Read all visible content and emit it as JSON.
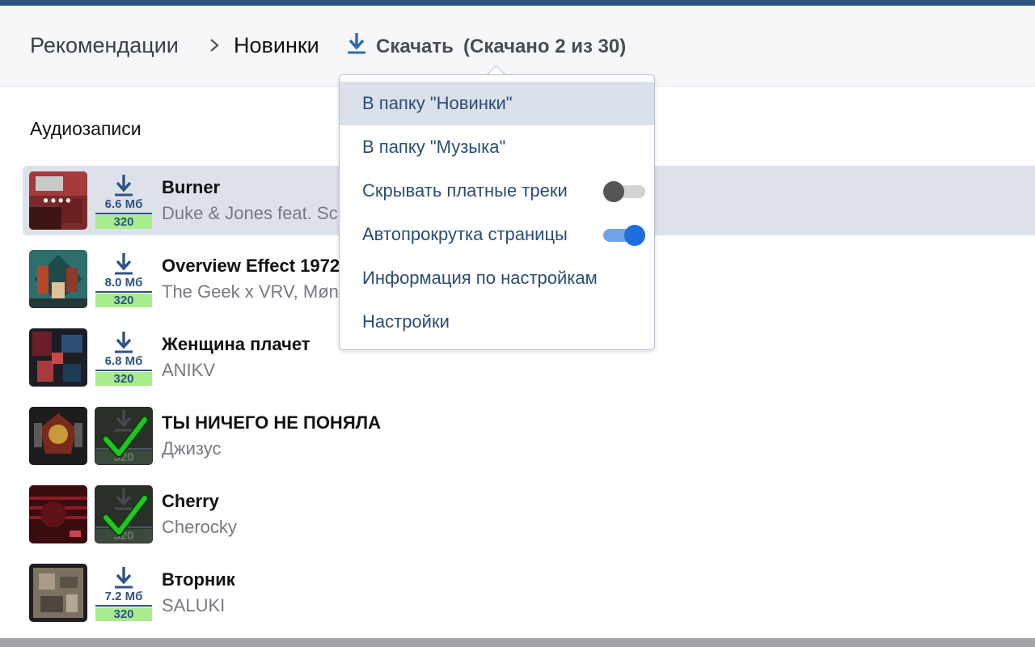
{
  "breadcrumb": {
    "item1": "Рекомендации",
    "item2": "Новинки",
    "download_label": "Скачать",
    "download_status": "(Скачано 2 из 30)"
  },
  "section_title": "Аудиозаписи",
  "menu": {
    "items": [
      {
        "label": "В папку \"Новинки\""
      },
      {
        "label": "В папку \"Музыка\""
      },
      {
        "label": "Скрывать платные треки",
        "toggle": false
      },
      {
        "label": "Автопрокрутка страницы",
        "toggle": true
      },
      {
        "label": "Информация по настройкам"
      },
      {
        "label": "Настройки"
      }
    ]
  },
  "tracks": [
    {
      "title": "Burner",
      "artist": "Duke & Jones feat. Sc",
      "size": "6.6 Мб",
      "bitrate": "320",
      "downloaded": false,
      "cover_text": "••••"
    },
    {
      "title": "Overview Effect 1972",
      "artist": "The Geek x VRV, Møn",
      "size": "8.0 Мб",
      "bitrate": "320",
      "downloaded": false
    },
    {
      "title": "Женщина плачет",
      "artist": "ANIKV",
      "size": "6.8 Мб",
      "bitrate": "320",
      "downloaded": false
    },
    {
      "title": "ТЫ НИЧЕГО НЕ ПОНЯЛА",
      "artist": "Джизус",
      "size": "",
      "bitrate": "320",
      "downloaded": true
    },
    {
      "title": "Cherry",
      "artist": "Cherocky",
      "size": "",
      "bitrate": "320",
      "downloaded": true
    },
    {
      "title": "Вторник",
      "artist": "SALUKI",
      "size": "7.2 Мб",
      "bitrate": "320",
      "downloaded": false
    }
  ],
  "colors": {
    "accent": "#2f5383",
    "bitrate_bg": "#a8ec8c",
    "menu_highlight": "#dbe1ea",
    "row_highlight": "#dde2ea",
    "toggle_on": "#1f6ee0",
    "check": "#22c422"
  }
}
